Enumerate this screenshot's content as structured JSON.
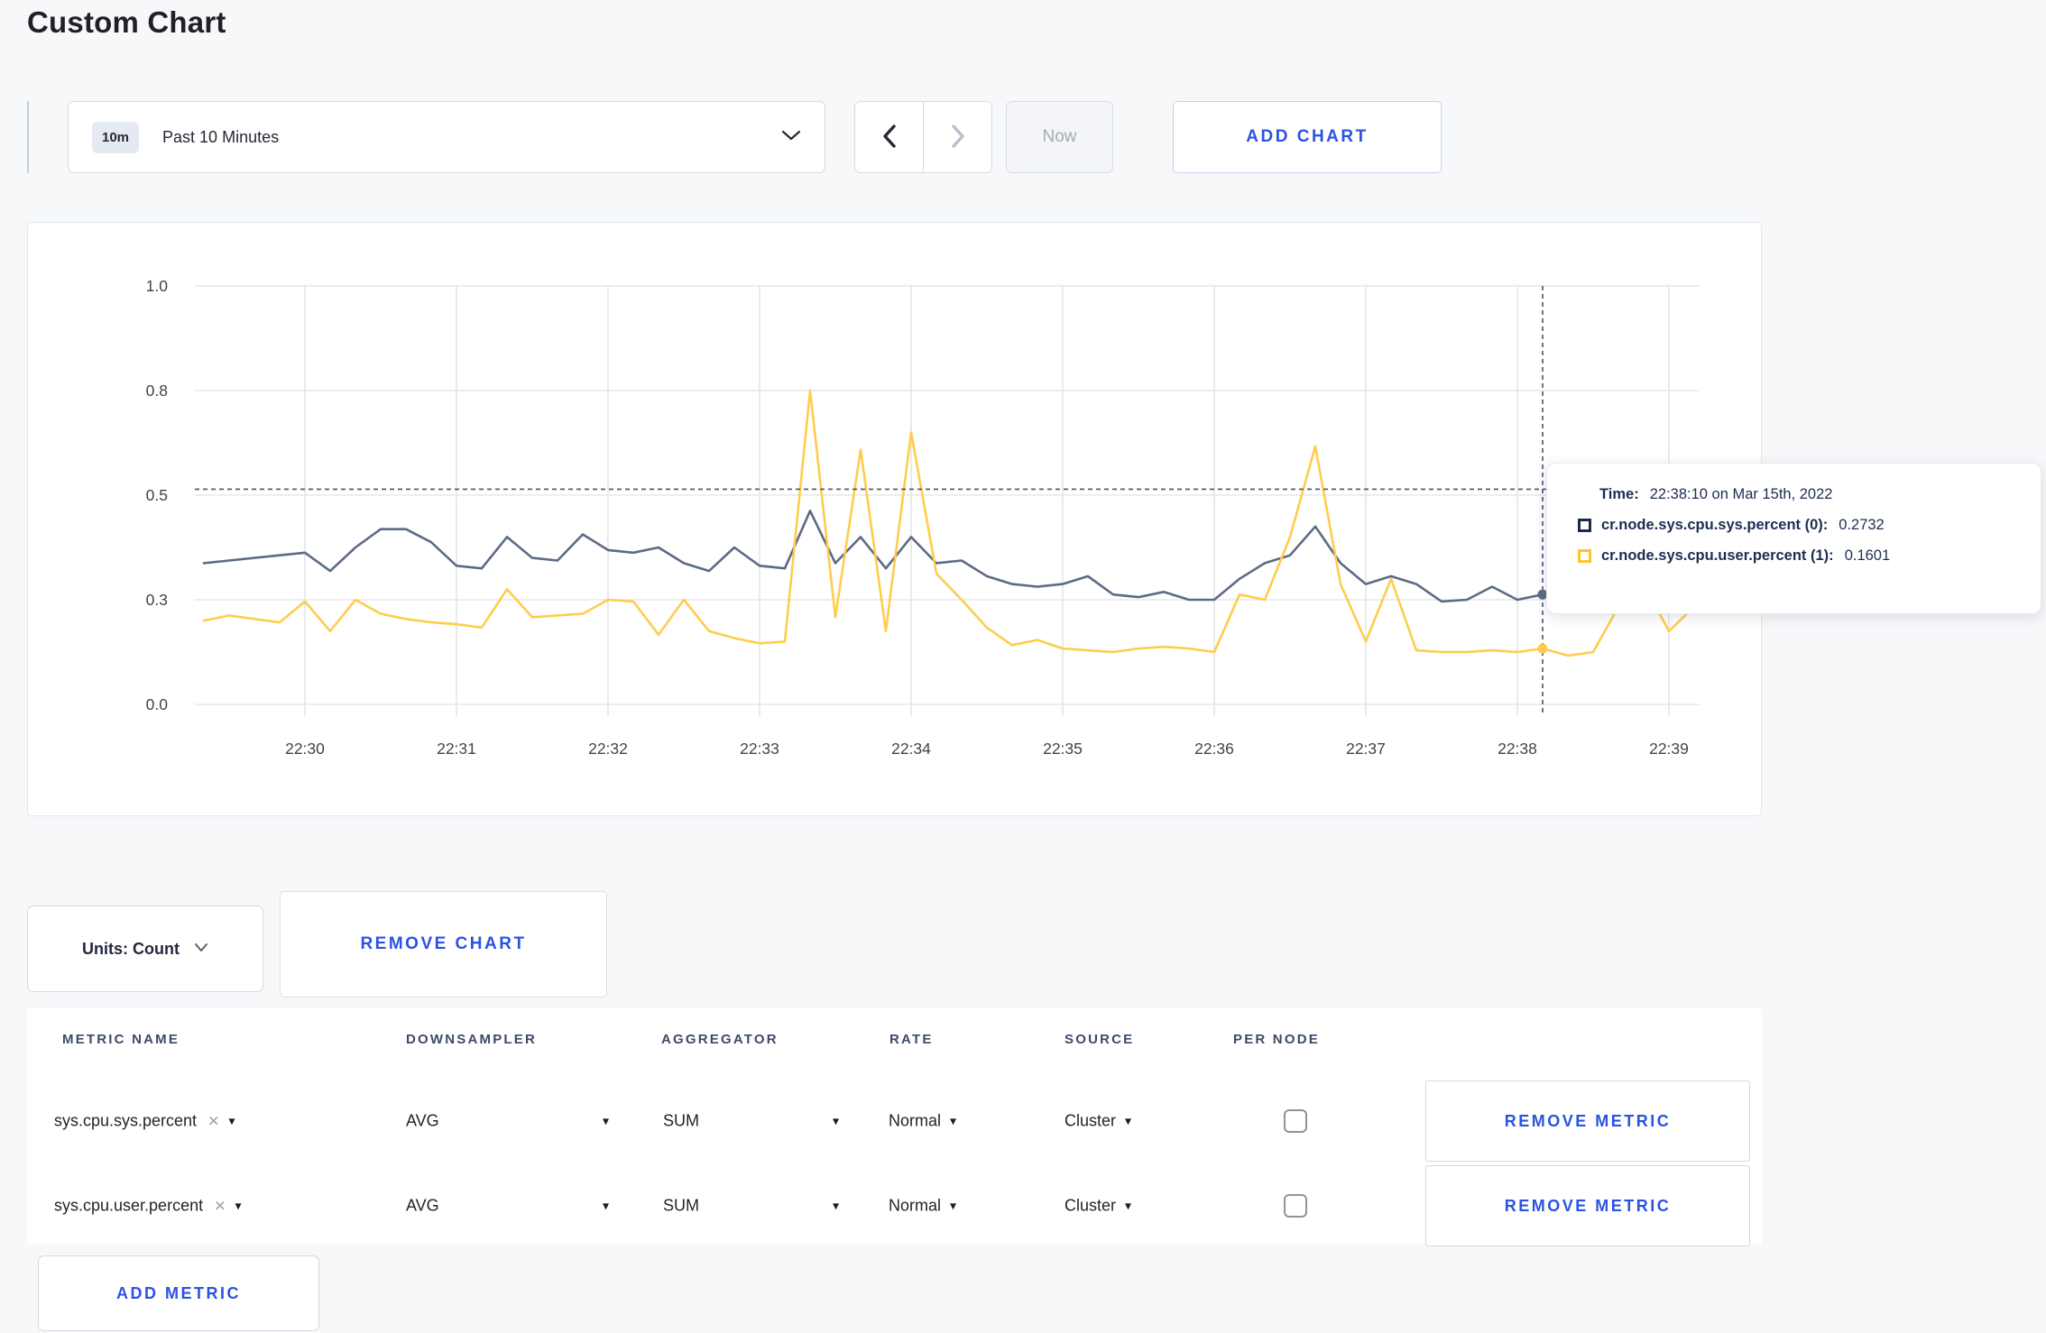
{
  "page": {
    "title": "Custom Chart"
  },
  "toolbar": {
    "range_badge": "10m",
    "range_label": "Past 10 Minutes",
    "now_label": "Now",
    "add_chart_label": "ADD CHART"
  },
  "chart_data": {
    "type": "line",
    "x_ticks": [
      "22:30",
      "22:31",
      "22:32",
      "22:33",
      "22:34",
      "22:35",
      "22:36",
      "22:37",
      "22:38",
      "22:39"
    ],
    "y_ticks": [
      0.0,
      0.3,
      0.5,
      0.8,
      1.0
    ],
    "y_tick_labels": [
      "0.0",
      "0.3",
      "0.5",
      "0.8",
      "1.0"
    ],
    "grid": true,
    "start_time": "22:29:20",
    "interval_s": 10,
    "start_offset_s": -40,
    "series": [
      {
        "name": "cr.node.sys.cpu.sys.percent",
        "color": "#5c6b85",
        "values": [
          0.37,
          0.375,
          0.38,
          0.385,
          0.39,
          0.355,
          0.4,
          0.435,
          0.435,
          0.41,
          0.365,
          0.36,
          0.42,
          0.38,
          0.375,
          0.425,
          0.395,
          0.39,
          0.4,
          0.37,
          0.355,
          0.4,
          0.365,
          0.36,
          0.47,
          0.37,
          0.42,
          0.36,
          0.42,
          0.37,
          0.375,
          0.345,
          0.33,
          0.325,
          0.33,
          0.345,
          0.31,
          0.305,
          0.315,
          0.3,
          0.3,
          0.34,
          0.37,
          0.385,
          0.44,
          0.37,
          0.33,
          0.345,
          0.33,
          0.295,
          0.3,
          0.325,
          0.3,
          0.31,
          0.305,
          0.3,
          0.31,
          0.3,
          0.305,
          0.3
        ]
      },
      {
        "name": "cr.node.sys.cpu.user.percent",
        "color": "#ffcd4d",
        "values": [
          0.24,
          0.255,
          0.245,
          0.235,
          0.295,
          0.21,
          0.3,
          0.26,
          0.245,
          0.235,
          0.23,
          0.22,
          0.32,
          0.25,
          0.255,
          0.26,
          0.3,
          0.295,
          0.2,
          0.3,
          0.21,
          0.19,
          0.175,
          0.18,
          0.8,
          0.25,
          0.63,
          0.21,
          0.68,
          0.35,
          0.3,
          0.22,
          0.17,
          0.185,
          0.16,
          0.155,
          0.15,
          0.16,
          0.165,
          0.16,
          0.15,
          0.31,
          0.3,
          0.42,
          0.64,
          0.33,
          0.18,
          0.34,
          0.155,
          0.15,
          0.15,
          0.155,
          0.15,
          0.16,
          0.14,
          0.15,
          0.28,
          0.33,
          0.21,
          0.28
        ]
      }
    ],
    "crosshair": {
      "time": "22:38:10",
      "offset_s": 490,
      "h_value": 0.517
    }
  },
  "tooltip": {
    "time_label": "Time:",
    "time_value": "22:38:10 on Mar 15th, 2022",
    "series": [
      {
        "label": "cr.node.sys.cpu.sys.percent (0):",
        "value": "0.2732",
        "swatch": "#1b2b4e"
      },
      {
        "label": "cr.node.sys.cpu.user.percent (1):",
        "value": "0.1601",
        "swatch": "#ffc529"
      }
    ]
  },
  "units": {
    "label": "Units: Count",
    "remove_chart_label": "REMOVE CHART"
  },
  "table": {
    "headers": [
      "METRIC NAME",
      "DOWNSAMPLER",
      "AGGREGATOR",
      "RATE",
      "SOURCE",
      "PER NODE"
    ],
    "rows": [
      {
        "metric": "sys.cpu.sys.percent",
        "downsampler": "AVG",
        "aggregator": "SUM",
        "rate": "Normal",
        "source": "Cluster",
        "per_node": false,
        "remove_label": "REMOVE METRIC"
      },
      {
        "metric": "sys.cpu.user.percent",
        "downsampler": "AVG",
        "aggregator": "SUM",
        "rate": "Normal",
        "source": "Cluster",
        "per_node": false,
        "remove_label": "REMOVE METRIC"
      }
    ],
    "add_metric_label": "ADD METRIC"
  },
  "icons": {
    "dropdown_caret": "▾",
    "close": "✕"
  },
  "colors": {
    "accent_blue": "#2b53e0",
    "page_bg": "#f7f8fa",
    "crosshair": "#44546e"
  }
}
